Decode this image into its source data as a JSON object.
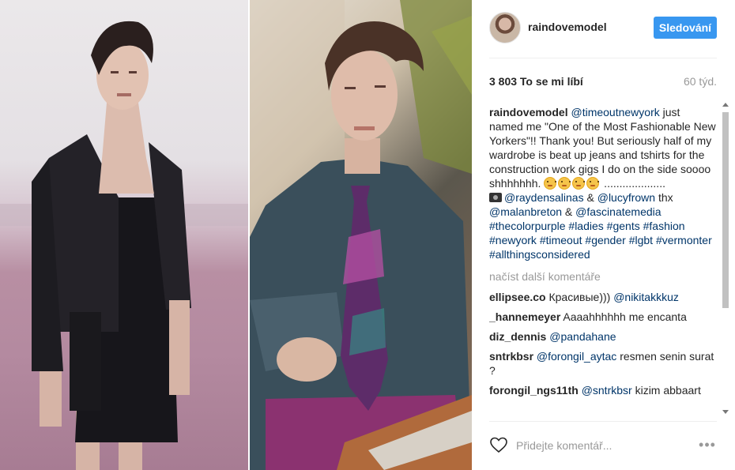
{
  "post": {
    "username": "raindovemodel",
    "follow_label": "Sledování",
    "likes": "3 803 To se mi líbí",
    "age": "60 týd.",
    "caption": {
      "user": "raindovemodel",
      "mention_timeout": "@timeoutnewyork",
      "text1": " just named me \"One of the Most Fashionable New Yorkers\"!! Thank you! But seriously half of my wardrobe is beat up jeans and tshirts for the construction work gigs I do on the side soooo shhhhhhh.",
      "text2": " ....................",
      "m1": "@raydensalinas",
      "amp1": " & ",
      "m2": "@lucyfrown",
      "thx": " thx ",
      "m3": "@malanbreton",
      "amp2": " & ",
      "m4": "@fascinatemedia",
      "h1": "#thecolorpurple",
      "h2": "#ladies",
      "h3": "#gents",
      "h4": "#fashion",
      "h5": "#newyork",
      "h6": "#timeout",
      "h7": "#gender",
      "h8": "#lgbt",
      "h9": "#vermonter",
      "h10": "#allthingsconsidered"
    },
    "load_more": "načíst další komentáře",
    "comments": [
      {
        "user": "ellipsee.co",
        "text": " Красивые))) ",
        "mention": "@nikitakkkuz"
      },
      {
        "user": "_hannemeyer",
        "text": " Aaaahhhhhh me encanta",
        "mention": ""
      },
      {
        "user": "diz_dennis",
        "text": " ",
        "mention": "@pandahane"
      },
      {
        "user": "sntrkbsr",
        "mention": "@forongil_aytac",
        "text": " resmen senin surat ?"
      },
      {
        "user": "forongil_ngs11th",
        "mention": "@sntrkbsr",
        "text": " kizim abbaart"
      }
    ],
    "comment_placeholder": "Přidejte komentář...",
    "more_label": "•••"
  },
  "icons": {
    "heart": "heart-icon",
    "more": "more-options-icon",
    "camera": "camera-emoji",
    "emoji": "flushed-face-emoji"
  },
  "colors": {
    "accent": "#3897f0",
    "link": "#003569",
    "muted": "#999999"
  }
}
